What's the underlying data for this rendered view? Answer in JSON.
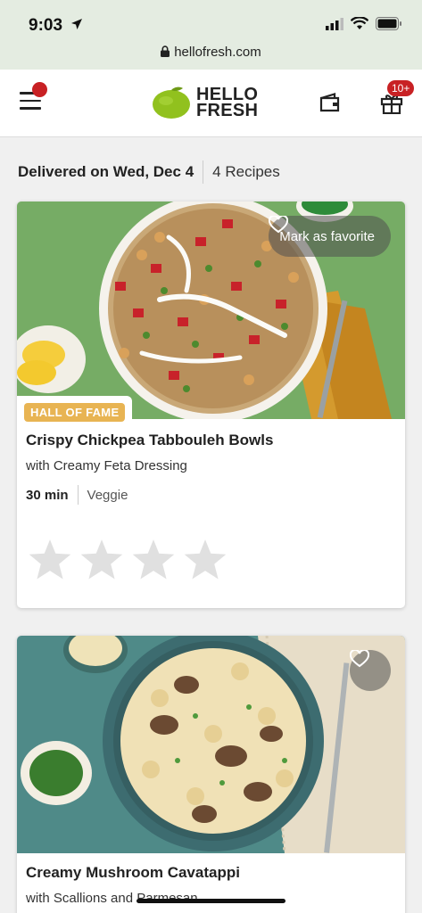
{
  "status": {
    "time": "9:03",
    "url": "hellofresh.com"
  },
  "header": {
    "logo_line1": "HELLO",
    "logo_line2": "FRESH",
    "cart_badge": "10+"
  },
  "delivery": {
    "date": "Delivered on Wed, Dec 4",
    "count": "4 Recipes"
  },
  "recipes": [
    {
      "favorite_label": "Mark as favorite",
      "badge": "HALL OF FAME",
      "title": "Crispy Chickpea Tabbouleh Bowls",
      "subtitle": "with Creamy Feta Dressing",
      "time": "30 min",
      "tag": "Veggie",
      "rating_stars": 4
    },
    {
      "title": "Creamy Mushroom Cavatappi",
      "subtitle": "with Scallions and Parmesan"
    }
  ],
  "colors": {
    "brand_green": "#91c11e",
    "badge_gold": "#e8b453",
    "alert_red": "#c82124"
  }
}
